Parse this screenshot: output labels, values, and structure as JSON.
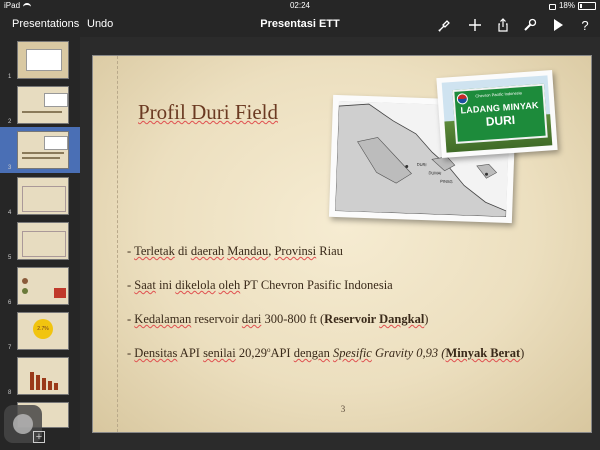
{
  "status_bar": {
    "device": "iPad",
    "time": "02:24",
    "battery": "18%",
    "battery_level": 0.18
  },
  "toolbar": {
    "presentations_label": "Presentations",
    "undo_label": "Undo",
    "title": "Presentasi ETT",
    "icons": [
      "brush-icon",
      "plus-icon",
      "share-icon",
      "wrench-icon",
      "play-icon",
      "help-icon"
    ],
    "help_glyph": "?"
  },
  "navigator": {
    "selected_index": 2,
    "slides": [
      {
        "number": "1"
      },
      {
        "number": "2"
      },
      {
        "number": "3"
      },
      {
        "number": "4"
      },
      {
        "number": "5"
      },
      {
        "number": "6"
      },
      {
        "number": "7"
      },
      {
        "number": "8"
      }
    ],
    "thumb_7_text": "2.7%",
    "add_glyph": "+"
  },
  "slide": {
    "title": "Profil Duri Field",
    "sign_header": "Chevron Pacific Indonesia",
    "sign_line1": "LADANG MINYAK",
    "sign_line2": "DURI",
    "map_labels": [
      "DURI",
      "DUMAI",
      "PINSG"
    ],
    "bullets": {
      "b1": {
        "dash": "- ",
        "w1": "Terletak",
        "t1": " di ",
        "w2": "daerah",
        "t2": " ",
        "w3": "Mandau",
        "t3": ", ",
        "w4": "Provinsi",
        "t4": " Riau"
      },
      "b2": {
        "dash": "- ",
        "w1": "Saat",
        "t1": " ini ",
        "w2": "dikelola",
        "t2": " ",
        "w3": "oleh",
        "t3": " PT Chevron Pasific Indonesia"
      },
      "b3": {
        "dash": "- ",
        "w1": "Kedalaman",
        "t1": " reservoir ",
        "w2": "dari",
        "t2": " 300-800 ft (",
        "bold1": "Reservoir ",
        "bold2": "Dangkal",
        "t3": ")"
      },
      "b4": {
        "dash": "- ",
        "w1": "Densitas",
        "t1": " API ",
        "w2": "senilai",
        "t2": " 20,29",
        "sup": "o",
        "t3": "API ",
        "w3": "dengan",
        "t4": " ",
        "w4": "Spesific",
        "t5": " Gravity 0,93 (",
        "bold1": "Minyak Berat",
        "t6": ")"
      }
    },
    "page_number": "3"
  },
  "colors": {
    "selection": "#4a6fb5",
    "title": "#6b3a22",
    "sign_green": "#1d8b3b"
  }
}
